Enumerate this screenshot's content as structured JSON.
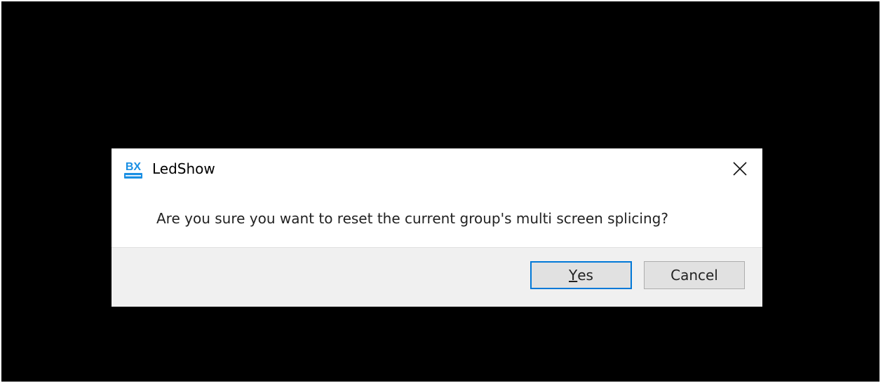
{
  "dialog": {
    "title": "LedShow",
    "icon": "bx-ledshow-app-icon",
    "close_icon": "close-icon",
    "message": "Are you sure you want to reset the current group's multi screen splicing?",
    "buttons": {
      "yes_mnemonic": "Y",
      "yes_rest": "es",
      "cancel_label": "Cancel"
    }
  },
  "colors": {
    "backdrop": "#000000",
    "dialog_background": "#ffffff",
    "footer_background": "#f0f0f0",
    "default_button_border": "#0078d7",
    "button_background": "#e1e1e1",
    "icon_blue": "#1a8fe3"
  }
}
